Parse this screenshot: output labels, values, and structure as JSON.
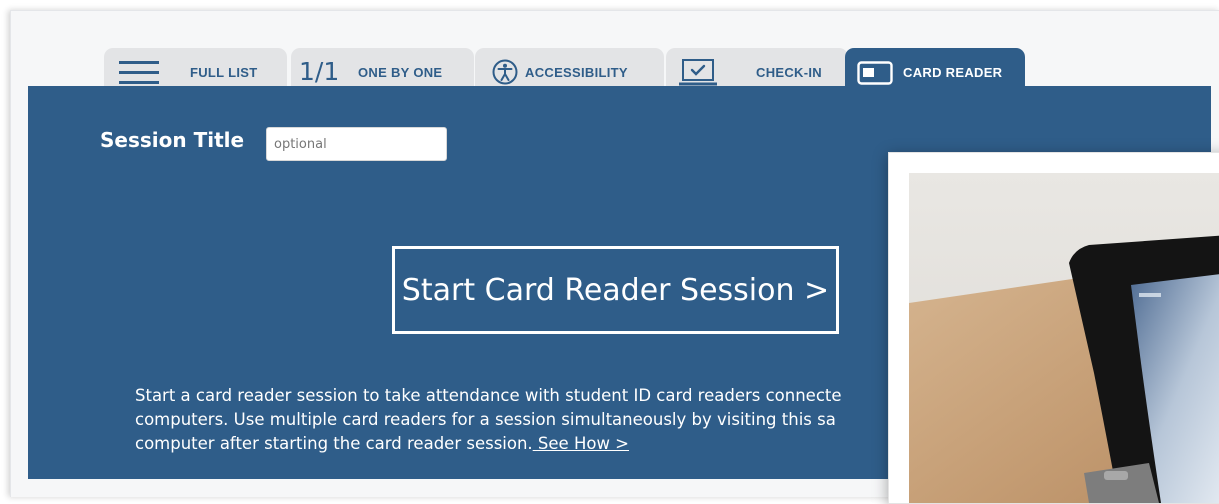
{
  "tabs": [
    {
      "label": "FULL LIST",
      "icon": "hamburger-icon",
      "active": false
    },
    {
      "label": "ONE BY ONE",
      "icon_text": "1/1",
      "icon": "one-of-one-icon",
      "active": false
    },
    {
      "label": "ACCESSIBILITY",
      "icon": "accessibility-icon",
      "active": false
    },
    {
      "label": "CHECK-IN",
      "icon": "laptop-check-icon",
      "active": false
    },
    {
      "label": "CARD READER",
      "icon": "card-reader-icon",
      "active": true
    }
  ],
  "session": {
    "title_label": "Session Title",
    "title_placeholder": "optional",
    "title_value": ""
  },
  "start_button_label": "Start Card Reader Session >",
  "description": {
    "line1": "Start a card reader session to take attendance with student ID card readers connecte",
    "line2": "computers. Use multiple card readers for a session simultaneously by visiting this sa",
    "line3": "computer after starting the card reader session.",
    "link": " See How >"
  },
  "colors": {
    "primary": "#2f5d89",
    "tab_inactive": "#e3e4e6",
    "text_on_primary": "#ffffff"
  }
}
